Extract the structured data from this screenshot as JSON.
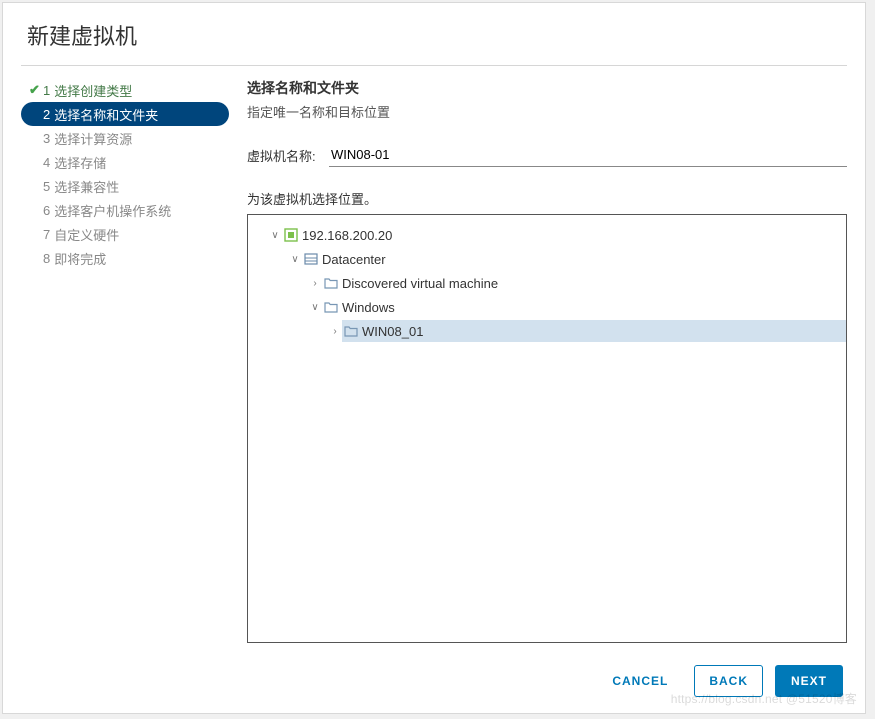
{
  "dialog": {
    "title": "新建虚拟机"
  },
  "steps": [
    {
      "num": "1",
      "label": "选择创建类型",
      "state": "completed"
    },
    {
      "num": "2",
      "label": "选择名称和文件夹",
      "state": "active"
    },
    {
      "num": "3",
      "label": "选择计算资源",
      "state": "pending"
    },
    {
      "num": "4",
      "label": "选择存储",
      "state": "pending"
    },
    {
      "num": "5",
      "label": "选择兼容性",
      "state": "pending"
    },
    {
      "num": "6",
      "label": "选择客户机操作系统",
      "state": "pending"
    },
    {
      "num": "7",
      "label": "自定义硬件",
      "state": "pending"
    },
    {
      "num": "8",
      "label": "即将完成",
      "state": "pending"
    }
  ],
  "panel": {
    "heading": "选择名称和文件夹",
    "subheading": "指定唯一名称和目标位置",
    "vm_name_label": "虚拟机名称:",
    "vm_name_value": "WIN08-01",
    "tree_caption": "为该虚拟机选择位置。"
  },
  "tree": {
    "root": {
      "label": "192.168.200.20",
      "expanded": true,
      "children": [
        {
          "label": "Datacenter",
          "expanded": true,
          "children": [
            {
              "label": "Discovered virtual machine",
              "expanded": false
            },
            {
              "label": "Windows",
              "expanded": true,
              "children": [
                {
                  "label": "WIN08_01",
                  "expanded": false,
                  "selected": true
                }
              ]
            }
          ]
        }
      ]
    }
  },
  "footer": {
    "cancel": "CANCEL",
    "back": "BACK",
    "next": "NEXT"
  },
  "watermark": "https://blog.csdn.net @51520博客"
}
